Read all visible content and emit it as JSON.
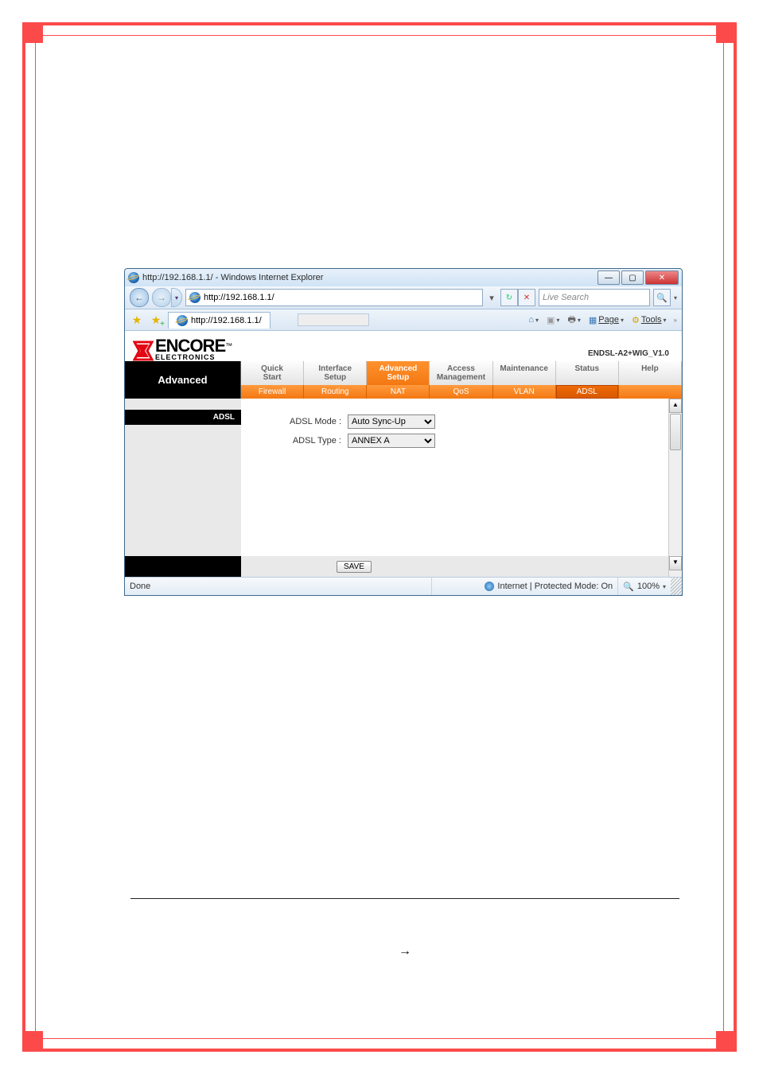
{
  "window": {
    "title": "http://192.168.1.1/ - Windows Internet Explorer",
    "url": "http://192.168.1.1/",
    "search_placeholder": "Live Search",
    "tab_label": "http://192.168.1.1/",
    "toolbar": {
      "page": "Page",
      "tools": "Tools"
    }
  },
  "brand": {
    "name": "ENCORE",
    "sub": "ELECTRONICS",
    "tm": "™"
  },
  "firmware": "ENDSL-A2+WIG_V1.0",
  "nav": {
    "section": "Advanced",
    "tabs": [
      "Quick\nStart",
      "Interface\nSetup",
      "Advanced\nSetup",
      "Access\nManagement",
      "Maintenance",
      "Status",
      "Help"
    ],
    "sub": [
      "Firewall",
      "Routing",
      "NAT",
      "QoS",
      "VLAN",
      "ADSL"
    ]
  },
  "side_heading": "ADSL",
  "form": {
    "mode_label": "ADSL Mode :",
    "mode_value": "Auto Sync-Up",
    "type_label": "ADSL Type :",
    "type_value": "ANNEX A",
    "save": "SAVE"
  },
  "status": {
    "done": "Done",
    "zone": "Internet | Protected Mode: On",
    "zoom": "100%"
  },
  "arrow": "→"
}
